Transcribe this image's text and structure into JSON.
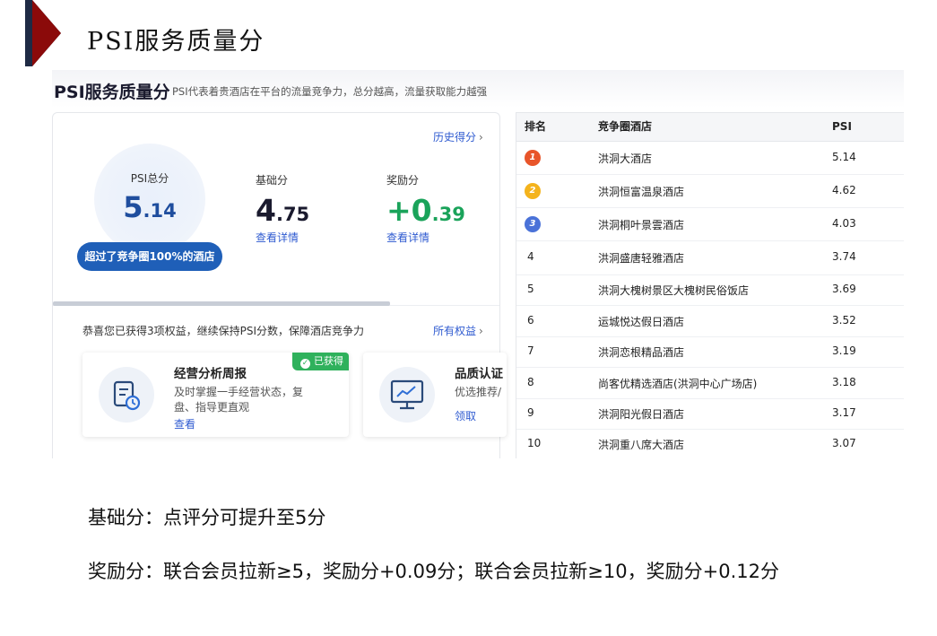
{
  "slide": {
    "title": "PSI服务质量分",
    "notes": [
      "基础分：点评分可提升至5分",
      "奖励分：联合会员拉新≥5，奖励分+0.09分；联合会员拉新≥10，奖励分+0.12分"
    ],
    "accent_color": "#8b0a0a"
  },
  "header": {
    "title": "PSI服务质量分",
    "description": "PSI代表着贵酒店在平台的流量竞争力，总分越高，流量获取能力越强"
  },
  "score_panel": {
    "history_link": "历史得分",
    "total_label": "PSI总分",
    "total_int": "5",
    "total_dec": ".14",
    "rank_text": "超过了竞争圈100%的酒店",
    "base_label": "基础分",
    "base_int": "4",
    "base_dec": ".75",
    "base_link": "查看详情",
    "bonus_label": "奖励分",
    "bonus_int": "+0",
    "bonus_dec": ".39",
    "bonus_link": "查看详情",
    "colors": {
      "total": "#1f4e9e",
      "bonus": "#1aa35a",
      "badge": "#1f5fb8"
    }
  },
  "rights": {
    "summary": "恭喜您已获得3项权益，继续保持PSI分数，保障酒店竞争力",
    "all_link": "所有权益",
    "cards": [
      {
        "title": "经营分析周报",
        "desc": "及时掌握一手经营状态，复盘、指导更直观",
        "link": "查看",
        "badge": "已获得",
        "icon": "report-clock-icon"
      },
      {
        "title": "品质认证",
        "desc": "优选推荐/",
        "link": "领取",
        "icon": "monitor-chart-icon"
      }
    ]
  },
  "ranking": {
    "columns": [
      "排名",
      "竞争圈酒店",
      "PSI"
    ],
    "rows": [
      {
        "rank": "1",
        "hotel": "洪洞大酒店",
        "psi": "5.14"
      },
      {
        "rank": "2",
        "hotel": "洪洞恒富温泉酒店",
        "psi": "4.62"
      },
      {
        "rank": "3",
        "hotel": "洪洞桐叶景雲酒店",
        "psi": "4.03"
      },
      {
        "rank": "4",
        "hotel": "洪洞盛唐轻雅酒店",
        "psi": "3.74"
      },
      {
        "rank": "5",
        "hotel": "洪洞大槐树景区大槐树民俗饭店",
        "psi": "3.69"
      },
      {
        "rank": "6",
        "hotel": "运城悦达假日酒店",
        "psi": "3.52"
      },
      {
        "rank": "7",
        "hotel": "洪洞恋根精品酒店",
        "psi": "3.19"
      },
      {
        "rank": "8",
        "hotel": "尚客优精选酒店(洪洞中心广场店)",
        "psi": "3.18"
      },
      {
        "rank": "9",
        "hotel": "洪洞阳光假日酒店",
        "psi": "3.17"
      },
      {
        "rank": "10",
        "hotel": "洪洞重八席大酒店",
        "psi": "3.07"
      }
    ],
    "medal_colors": [
      "#e8552a",
      "#f4b31c",
      "#4a72d8"
    ]
  }
}
